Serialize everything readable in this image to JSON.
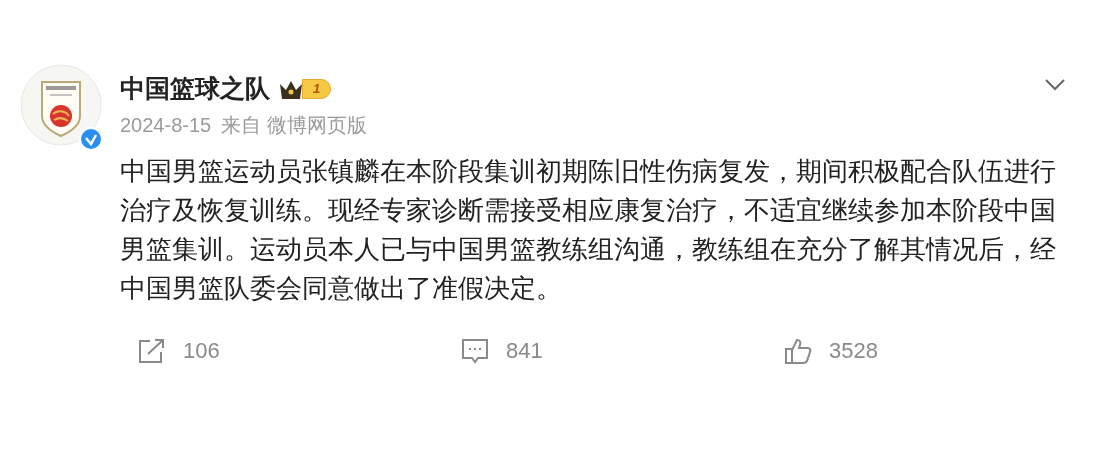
{
  "post": {
    "author": "中国篮球之队",
    "level_badge": "1",
    "verified": true,
    "date": "2024-8-15",
    "source": "来自 微博网页版",
    "body": "中国男篮运动员张镇麟在本阶段集训初期陈旧性伤病复发，期间积极配合队伍进行治疗及恢复训练。现经专家诊断需接受相应康复治疗，不适宜继续参加本阶段中国男篮集训。运动员本人已与中国男篮教练组沟通，教练组在充分了解其情况后，经中国男篮队委会同意做出了准假决定。",
    "actions": [
      {
        "kind": "repost",
        "count": "106"
      },
      {
        "kind": "comment",
        "count": "841"
      },
      {
        "kind": "like",
        "count": "3528"
      }
    ]
  }
}
